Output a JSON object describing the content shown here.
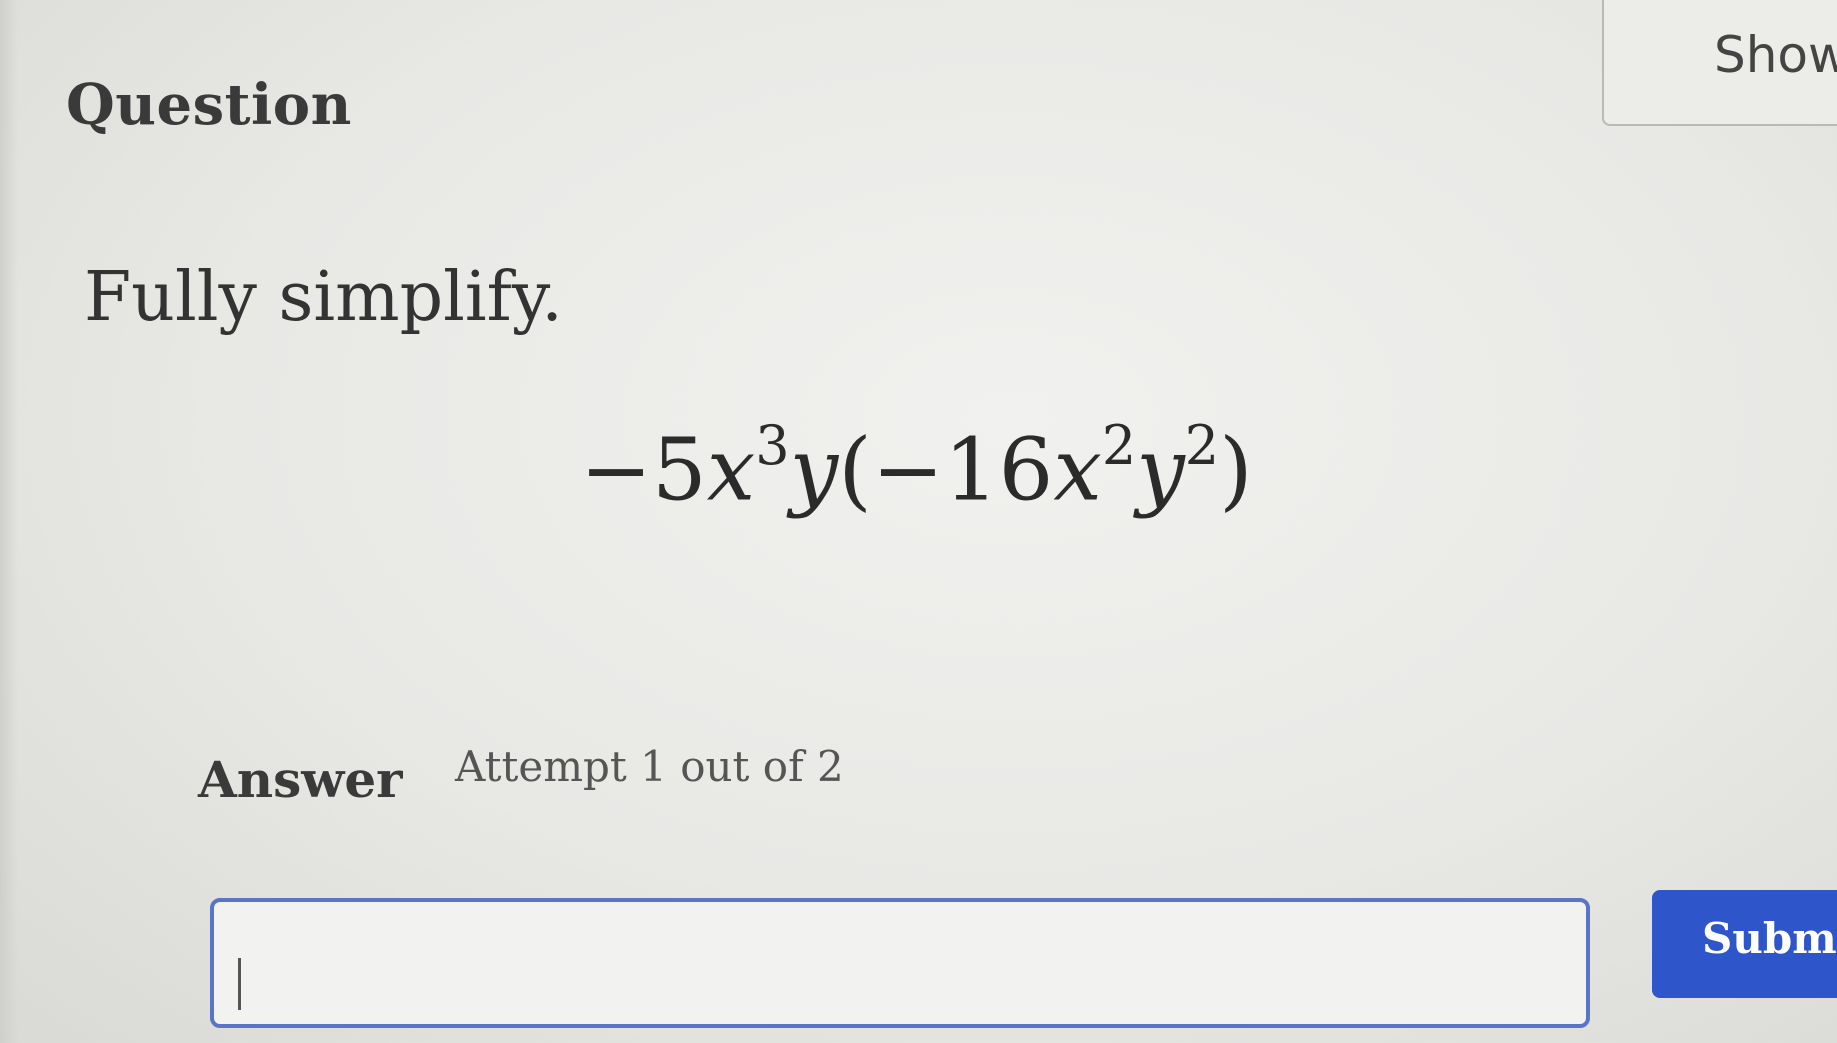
{
  "question": {
    "title": "Question",
    "show_button_label": "Show",
    "instruction": "Fully simplify.",
    "expression": {
      "coef1": "−5",
      "var1": "x",
      "exp1": "3",
      "var2": "y",
      "open_paren": "(",
      "coef2": "−16",
      "var3": "x",
      "exp2": "2",
      "var4": "y",
      "exp3": "2",
      "close_paren": ")"
    }
  },
  "answer": {
    "label": "Answer",
    "attempt_text": "Attempt 1 out of 2",
    "input_value": "",
    "submit_label": "Submit"
  },
  "colors": {
    "input_border": "#5b74c6",
    "submit_bg": "#2e55c9"
  }
}
